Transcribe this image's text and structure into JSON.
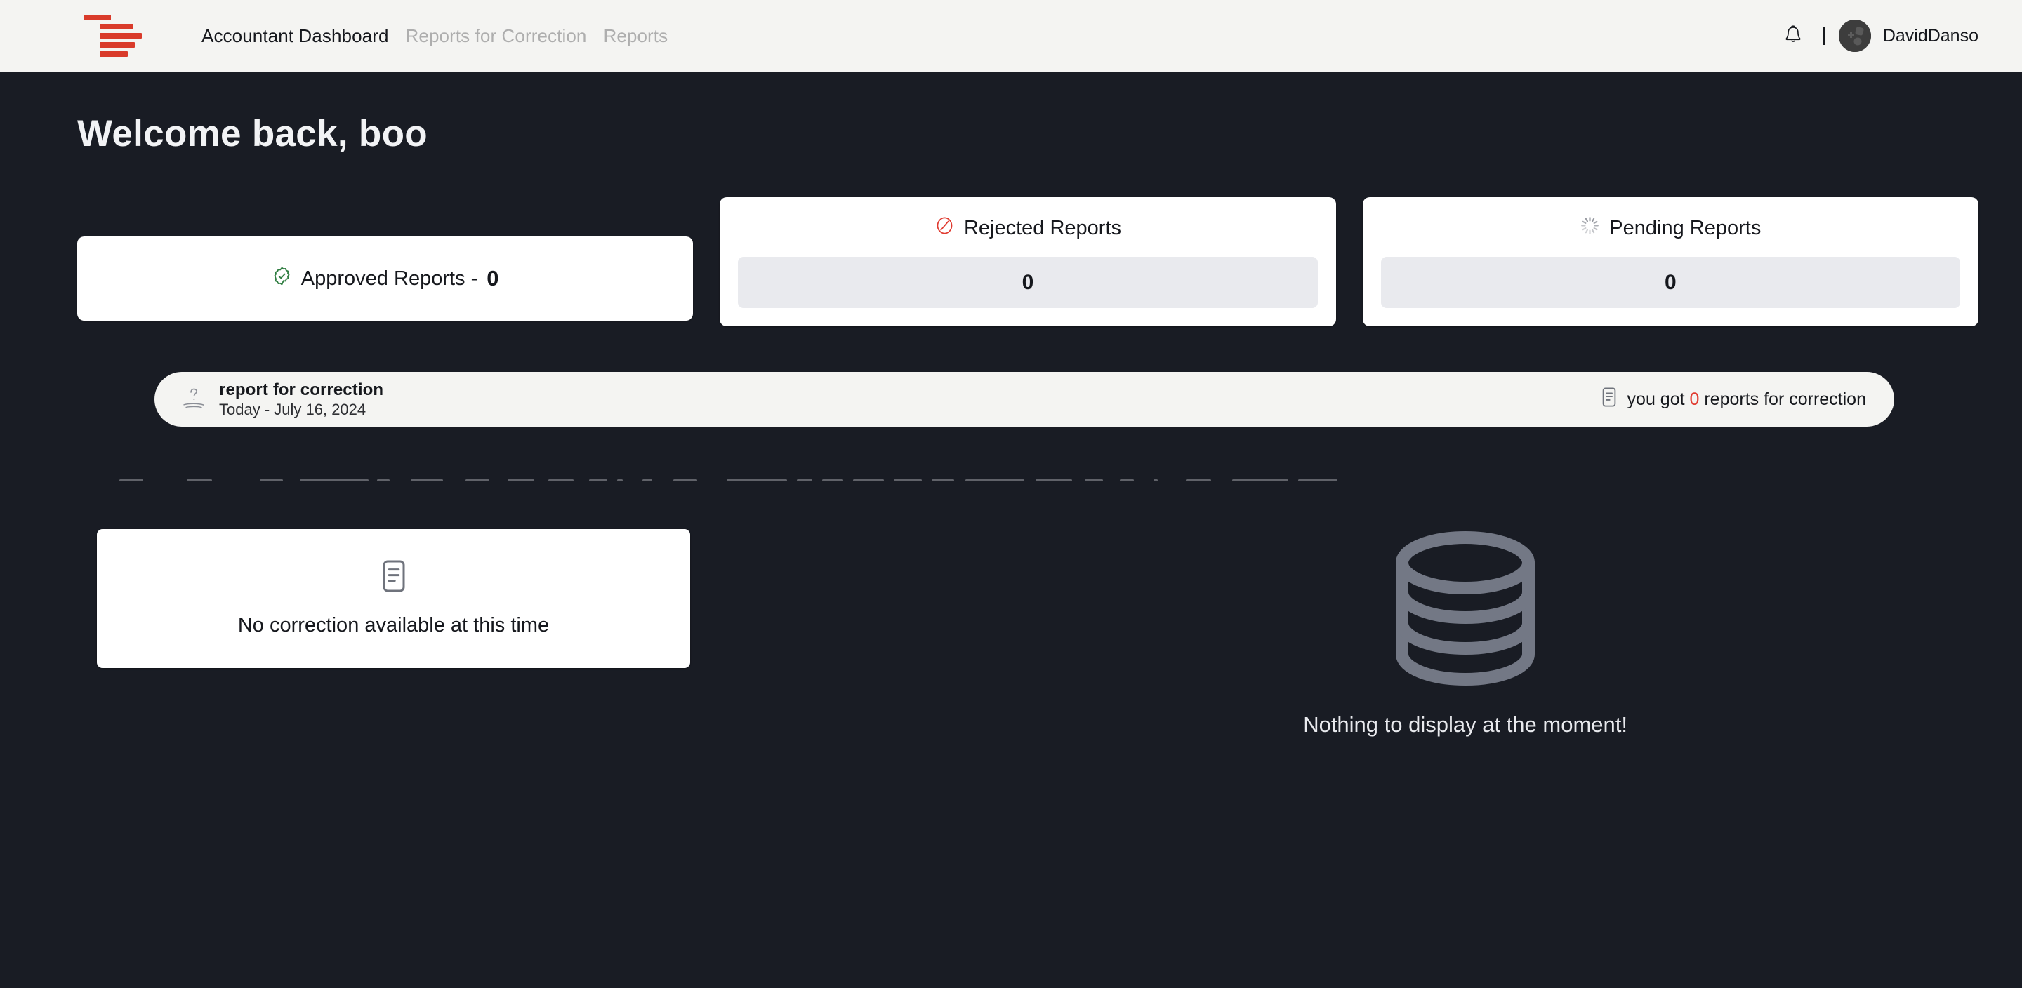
{
  "header": {
    "logo_icon": "stacked-bars-logo",
    "logo_color": "#d93b2b",
    "nav": [
      {
        "label": "Accountant Dashboard",
        "active": true
      },
      {
        "label": "Reports for Correction",
        "active": false
      },
      {
        "label": "Reports",
        "active": false
      }
    ],
    "bell_icon": "notification-bell-icon",
    "divider": "|",
    "avatar_icon": "user-avatar-shapes-icon",
    "user_name": "DavidDanso"
  },
  "main": {
    "page_title": "Welcome back, boo"
  },
  "stats": [
    {
      "key": "approved",
      "icon": "badge-check-icon",
      "icon_color": "#2f7d41",
      "label": "Approved Reports - ",
      "value": "0",
      "inline_value": true
    },
    {
      "key": "rejected",
      "icon": "ban-slash-icon",
      "icon_color": "#e03b30",
      "label": "Rejected Reports",
      "value": "0",
      "inline_value": false
    },
    {
      "key": "pending",
      "icon": "spinner-icon",
      "icon_color": "#8b8e96",
      "label": "Pending Reports",
      "value": "0",
      "inline_value": false
    }
  ],
  "banner": {
    "icon": "question-mark-squiggle-icon",
    "title": "report for correction",
    "subtitle": "Today - July 16, 2024",
    "status_icon": "document-lines-icon",
    "status_prefix": "you got ",
    "status_count": "0",
    "status_suffix": " reports for correction",
    "count_color": "#e03b30"
  },
  "divider_strip": {
    "name": "faint-dashed-separator",
    "dashes": [
      {
        "w": 34,
        "gap": 62
      },
      {
        "w": 36,
        "gap": 68
      },
      {
        "w": 33,
        "gap": 24
      },
      {
        "w": 98,
        "gap": 12
      },
      {
        "w": 18,
        "gap": 30
      },
      {
        "w": 46,
        "gap": 32
      },
      {
        "w": 34,
        "gap": 26
      },
      {
        "w": 38,
        "gap": 20
      },
      {
        "w": 36,
        "gap": 22
      },
      {
        "w": 26,
        "gap": 14
      },
      {
        "w": 8,
        "gap": 28
      },
      {
        "w": 14,
        "gap": 30
      },
      {
        "w": 34,
        "gap": 42
      },
      {
        "w": 86,
        "gap": 14
      },
      {
        "w": 22,
        "gap": 14
      },
      {
        "w": 30,
        "gap": 14
      },
      {
        "w": 44,
        "gap": 14
      },
      {
        "w": 40,
        "gap": 14
      },
      {
        "w": 32,
        "gap": 16
      },
      {
        "w": 84,
        "gap": 16
      },
      {
        "w": 52,
        "gap": 18
      },
      {
        "w": 26,
        "gap": 24
      },
      {
        "w": 20,
        "gap": 28
      },
      {
        "w": 6,
        "gap": 40
      },
      {
        "w": 36,
        "gap": 30
      },
      {
        "w": 80,
        "gap": 14
      },
      {
        "w": 56,
        "gap": 0
      }
    ]
  },
  "lower": {
    "empty_card": {
      "icon": "document-lines-icon",
      "text": "No correction available at this time"
    },
    "empty_state": {
      "icon": "database-stack-icon",
      "text": "Nothing to display at the moment!"
    }
  },
  "colors": {
    "background": "#191c24",
    "header_bg": "#f4f4f2",
    "card_bg": "#ffffff",
    "value_box_bg": "#e9eaee",
    "accent_red": "#d93b2b",
    "accent_green": "#2f7d41",
    "muted_gray": "#8b8e96"
  }
}
